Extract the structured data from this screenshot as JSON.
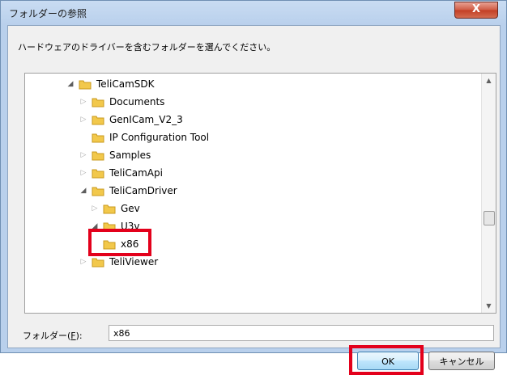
{
  "window": {
    "title": "フォルダーの参照",
    "close_label": "X"
  },
  "instruction": "ハードウェアのドライバーを含むフォルダーを選んでください。",
  "tree": {
    "items": [
      {
        "label": "TeliCamSDK",
        "expander": "◢"
      },
      {
        "label": "Documents",
        "expander": "▷"
      },
      {
        "label": "GenICam_V2_3",
        "expander": "▷"
      },
      {
        "label": "IP Configuration Tool",
        "expander": ""
      },
      {
        "label": "Samples",
        "expander": "▷"
      },
      {
        "label": "TeliCamApi",
        "expander": "▷"
      },
      {
        "label": "TeliCamDriver",
        "expander": "◢"
      },
      {
        "label": "Gev",
        "expander": "▷"
      },
      {
        "label": "U3v",
        "expander": "◢"
      },
      {
        "label": "x86",
        "expander": ""
      },
      {
        "label": "TeliViewer",
        "expander": "▷"
      }
    ],
    "scroll_up": "▲",
    "scroll_down": "▼"
  },
  "folder_field": {
    "label_prefix": "フォルダー(",
    "label_key": "F",
    "label_suffix": "):",
    "value": "x86"
  },
  "buttons": {
    "ok": "OK",
    "cancel": "キャンセル"
  },
  "colors": {
    "highlight_red": "#e3001b",
    "folder_yellow": "#f2c84b"
  }
}
